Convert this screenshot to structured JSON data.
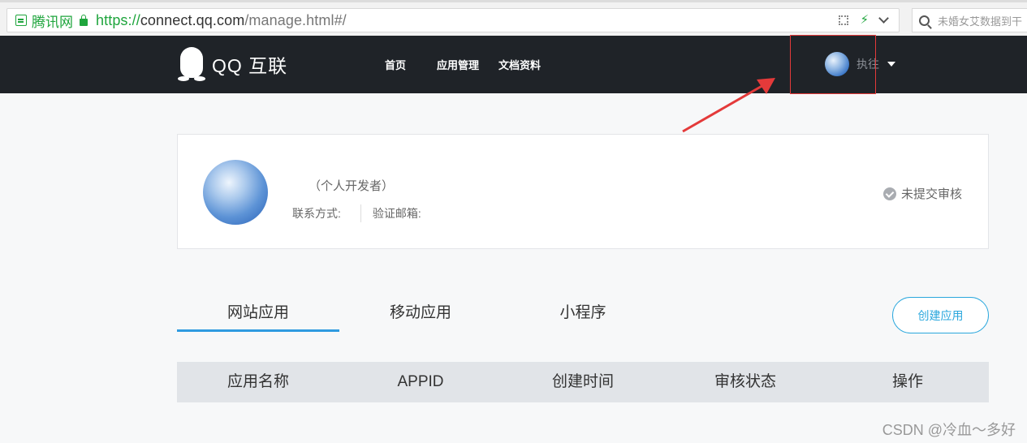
{
  "browser": {
    "site_name": "腾讯网",
    "url_scheme": "https://",
    "url_host": "connect.qq.com",
    "url_path": "/manage.html#/",
    "search_placeholder": "未婚女艾数据到干"
  },
  "header": {
    "logo_text": "QQ 互联",
    "nav": [
      "首页",
      "应用管理",
      "文档资料"
    ],
    "user_name": "执往"
  },
  "profile": {
    "developer_type": "（个人开发者）",
    "contact_label": "联系方式:",
    "email_label": "验证邮箱:",
    "status": "未提交审核"
  },
  "tabs": [
    "网站应用",
    "移动应用",
    "小程序"
  ],
  "create_button": "创建应用",
  "table": {
    "columns": [
      "应用名称",
      "APPID",
      "创建时间",
      "审核状态",
      "操作"
    ]
  },
  "watermark": "CSDN @冷血～多好",
  "colors": {
    "header_bg": "#1f2328",
    "accent": "#2f9be0",
    "annotation": "#e43a3a",
    "secure": "#1fa53d"
  }
}
